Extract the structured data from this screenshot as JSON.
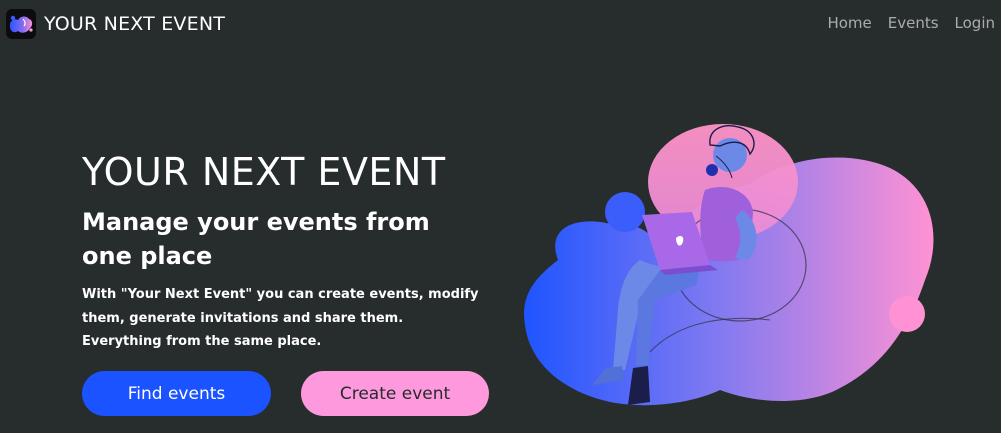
{
  "navbar": {
    "brand_name": "YOUR NEXT EVENT",
    "links": [
      {
        "label": "Home"
      },
      {
        "label": "Events"
      },
      {
        "label": "Login"
      }
    ]
  },
  "hero": {
    "title": "YOUR NEXT EVENT",
    "subtitle": "Manage your events from one place",
    "description": "With \"Your Next Event\" you can create events, modify them, generate invitations and share them. Everything from the same place.",
    "primary_button": "Find events",
    "secondary_button": "Create event"
  },
  "colors": {
    "background": "#272d2d",
    "primary": "#1a53ff",
    "secondary": "#ff99dd",
    "nav_text": "#a9acac"
  },
  "icons": {
    "logo": "blob-logo-icon",
    "illustration": "person-with-laptop-illustration"
  }
}
